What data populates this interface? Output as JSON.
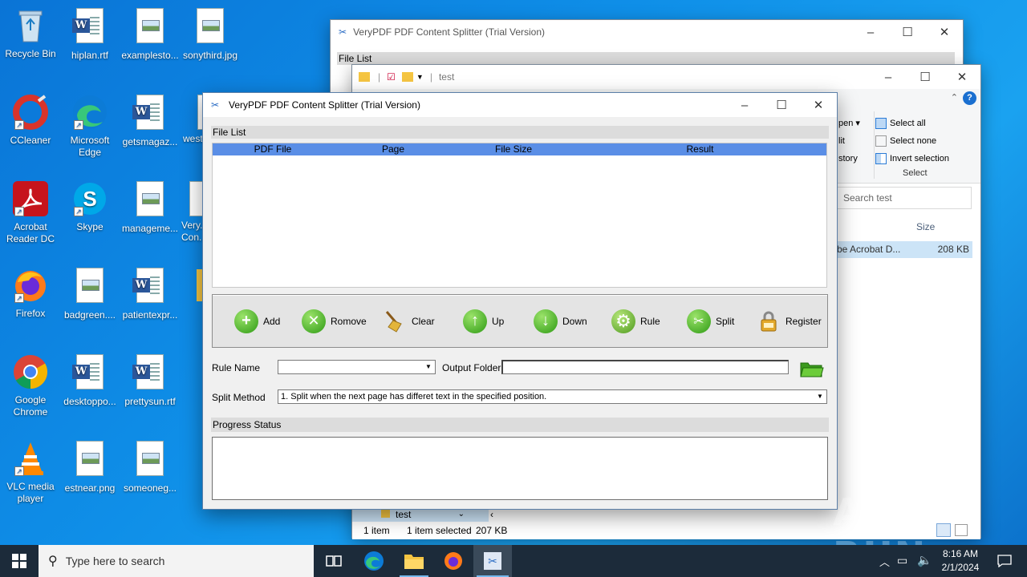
{
  "desktop": {
    "icons": [
      {
        "label": "Recycle Bin"
      },
      {
        "label": "hiplan.rtf"
      },
      {
        "label": "examplesto..."
      },
      {
        "label": "sonythird.jpg"
      },
      {
        "label": "CCleaner"
      },
      {
        "label": "Microsoft Edge"
      },
      {
        "label": "getsmagaz..."
      },
      {
        "label": "west..."
      },
      {
        "label": "Acrobat Reader DC"
      },
      {
        "label": "Skype"
      },
      {
        "label": "manageme..."
      },
      {
        "label": "Very... Con..."
      },
      {
        "label": "Firefox"
      },
      {
        "label": "badgreen...."
      },
      {
        "label": "patientexpr..."
      },
      {
        "label": "Google Chrome"
      },
      {
        "label": "desktoppo..."
      },
      {
        "label": "prettysun.rtf"
      },
      {
        "label": "VLC media player"
      },
      {
        "label": "estnear.png"
      },
      {
        "label": "someoneg..."
      }
    ]
  },
  "bg_app": {
    "title": "VeryPDF PDF Content Splitter (Trial Version)",
    "file_list_label": "File List"
  },
  "explorer": {
    "path_label": "test",
    "ribbon": {
      "open_partial": "pen",
      "edit_partial": "lit",
      "history_partial": "story",
      "select_all": "Select all",
      "select_none": "Select none",
      "invert_selection": "Invert selection",
      "group_label": "Select"
    },
    "search_placeholder": "Search test",
    "column_size": "Size",
    "file_row": {
      "name_partial": "be Acrobat D...",
      "size": "208 KB"
    },
    "nav_folder": "test",
    "status": {
      "items": "1 item",
      "selected": "1 item selected",
      "size": "207 KB"
    }
  },
  "app": {
    "title": "VeryPDF PDF Content Splitter (Trial Version)",
    "file_list_label": "File List",
    "columns": [
      "PDF File",
      "Page",
      "File Size",
      "Result"
    ],
    "toolbar": {
      "add": "Add",
      "remove": "Romove",
      "clear": "Clear",
      "up": "Up",
      "down": "Down",
      "rule": "Rule",
      "split": "Split",
      "register": "Register"
    },
    "rule_name_label": "Rule Name",
    "rule_name_value": "",
    "output_folder_label": "Output Folder",
    "output_folder_value": "",
    "split_method_label": "Split Method",
    "split_method_value": "1. Split when the next page has differet text in the specified position.",
    "progress_label": "Progress Status"
  },
  "taskbar": {
    "search_placeholder": "Type here to search",
    "time": "8:16 AM",
    "date": "2/1/2024"
  },
  "watermark": "ANY RUN"
}
